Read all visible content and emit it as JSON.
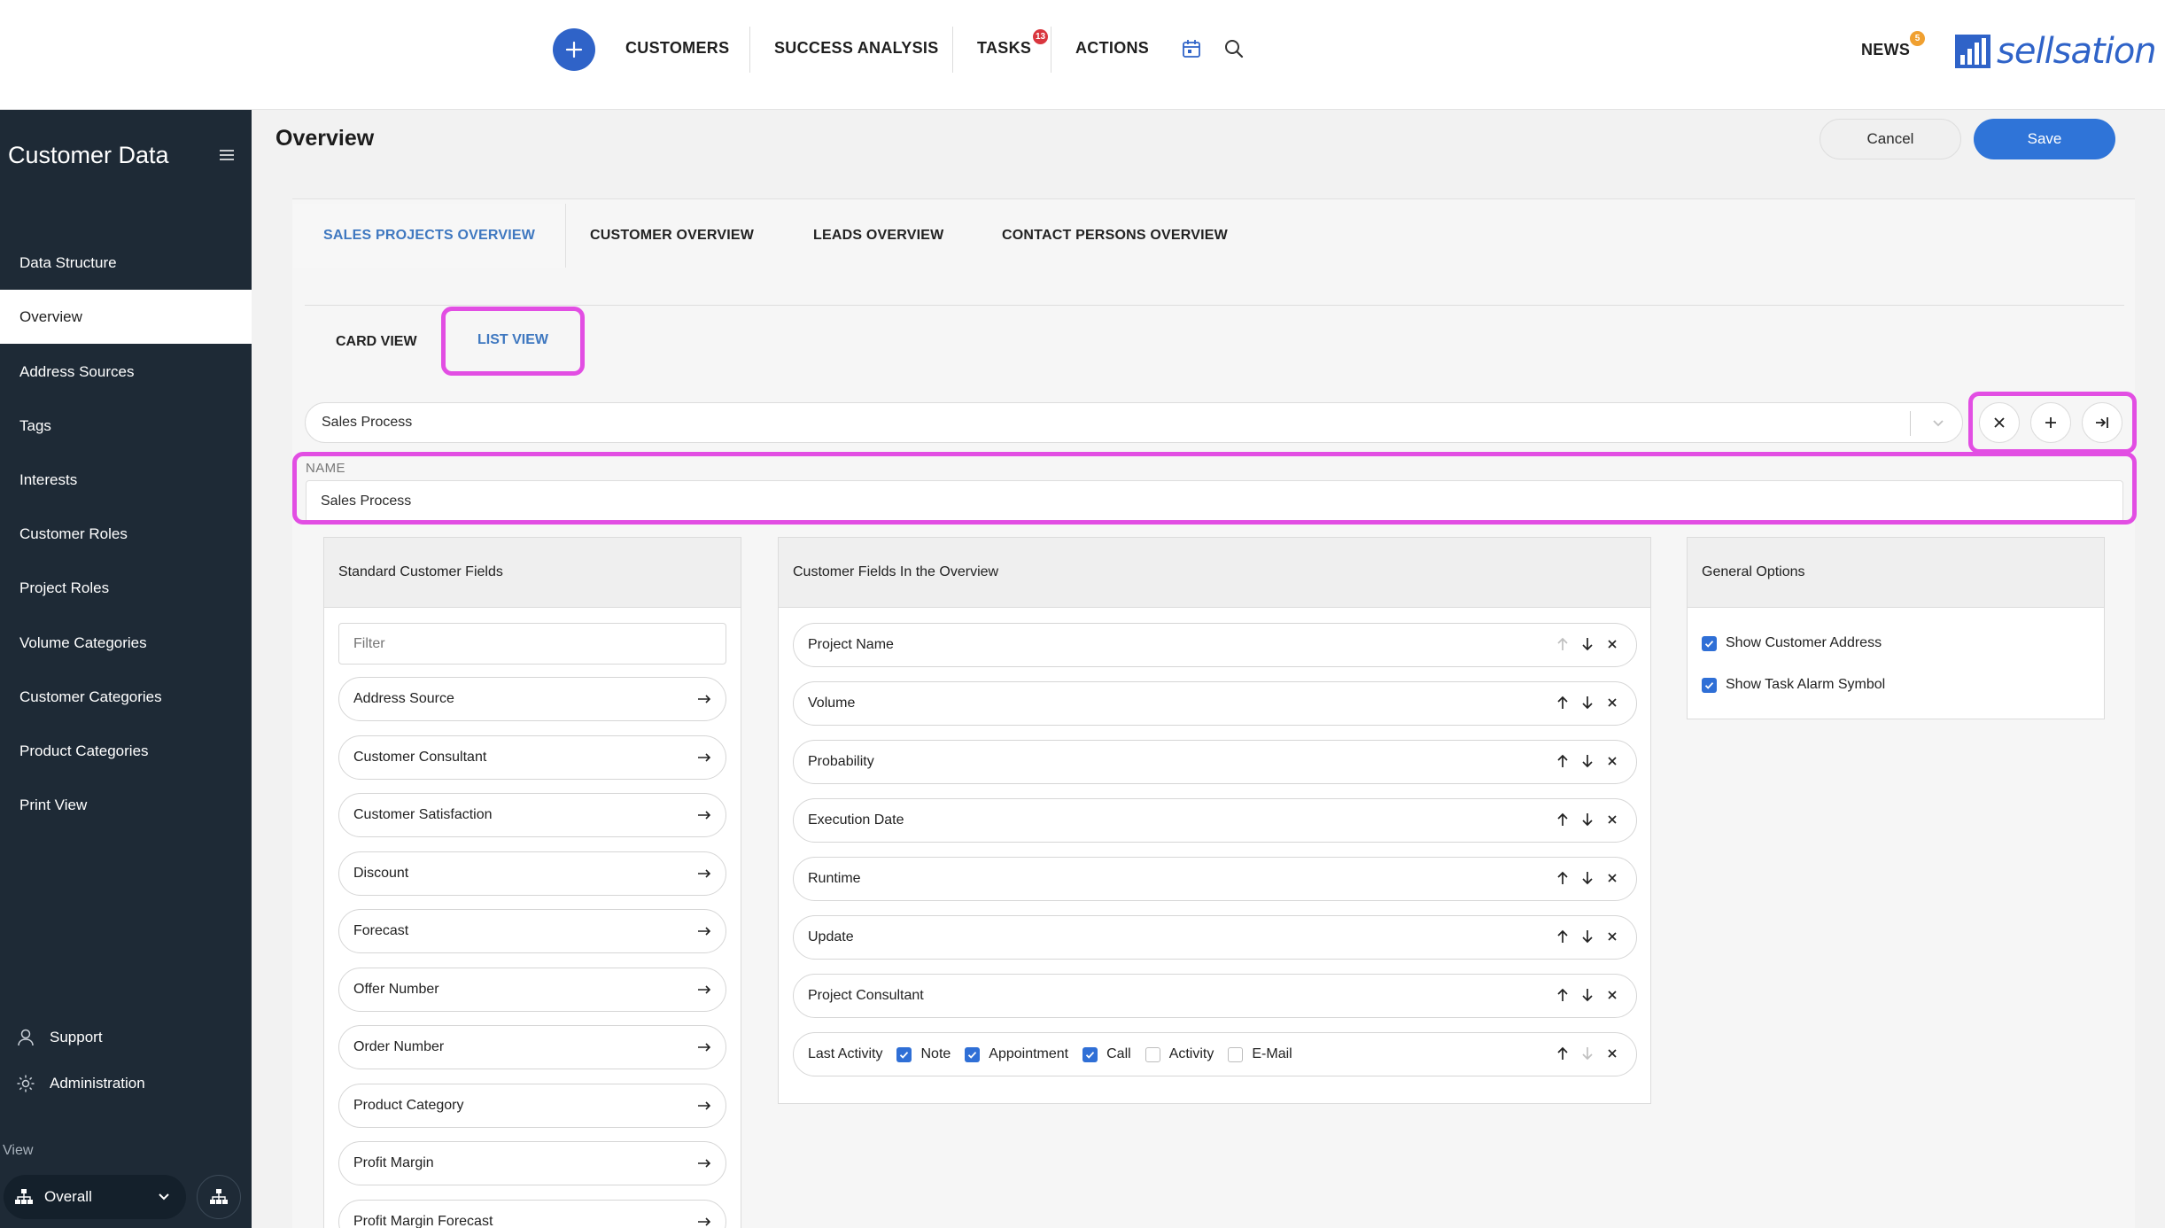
{
  "header": {
    "nav": [
      "CUSTOMERS",
      "SUCCESS ANALYSIS",
      "TASKS",
      "ACTIONS"
    ],
    "tasks_badge": "13",
    "news_label": "NEWS",
    "news_badge": "5",
    "logo_text": "sellsation",
    "brand_color": "#2f63c8"
  },
  "sidebar": {
    "title": "Customer Data",
    "items": [
      "Data Structure",
      "Overview",
      "Address Sources",
      "Tags",
      "Interests",
      "Customer Roles",
      "Project Roles",
      "Volume Categories",
      "Customer Categories",
      "Product Categories",
      "Print View"
    ],
    "active_item": "Overview",
    "support": "Support",
    "administration": "Administration",
    "view_label": "View",
    "view_value": "Overall"
  },
  "page": {
    "title": "Overview",
    "cancel": "Cancel",
    "save": "Save"
  },
  "tabs": [
    "SALES PROJECTS OVERVIEW",
    "CUSTOMER OVERVIEW",
    "LEADS OVERVIEW",
    "CONTACT PERSONS OVERVIEW"
  ],
  "active_tab": "SALES PROJECTS OVERVIEW",
  "subtabs": [
    "CARD VIEW",
    "LIST VIEW"
  ],
  "active_subtab": "LIST VIEW",
  "selector": {
    "value": "Sales Process"
  },
  "name_field": {
    "label": "NAME",
    "value": "Sales Process"
  },
  "standard_fields": {
    "title": "Standard Customer Fields",
    "filter_placeholder": "Filter",
    "items": [
      "Address Source",
      "Customer Consultant",
      "Customer Satisfaction",
      "Discount",
      "Forecast",
      "Offer Number",
      "Order Number",
      "Product Category",
      "Profit Margin",
      "Profit Margin Forecast"
    ]
  },
  "overview_fields": {
    "title": "Customer Fields In the Overview",
    "items": [
      "Project Name",
      "Volume",
      "Probability",
      "Execution Date",
      "Runtime",
      "Update",
      "Project Consultant"
    ],
    "last_activity": {
      "label": "Last Activity",
      "options": [
        {
          "label": "Note",
          "checked": true
        },
        {
          "label": "Appointment",
          "checked": true
        },
        {
          "label": "Call",
          "checked": true
        },
        {
          "label": "Activity",
          "checked": false
        },
        {
          "label": "E-Mail",
          "checked": false
        }
      ]
    }
  },
  "general_options": {
    "title": "General Options",
    "items": [
      {
        "label": "Show Customer Address",
        "checked": true
      },
      {
        "label": "Show Task Alarm Symbol",
        "checked": true
      }
    ]
  },
  "highlight_color": "#e24ee3"
}
